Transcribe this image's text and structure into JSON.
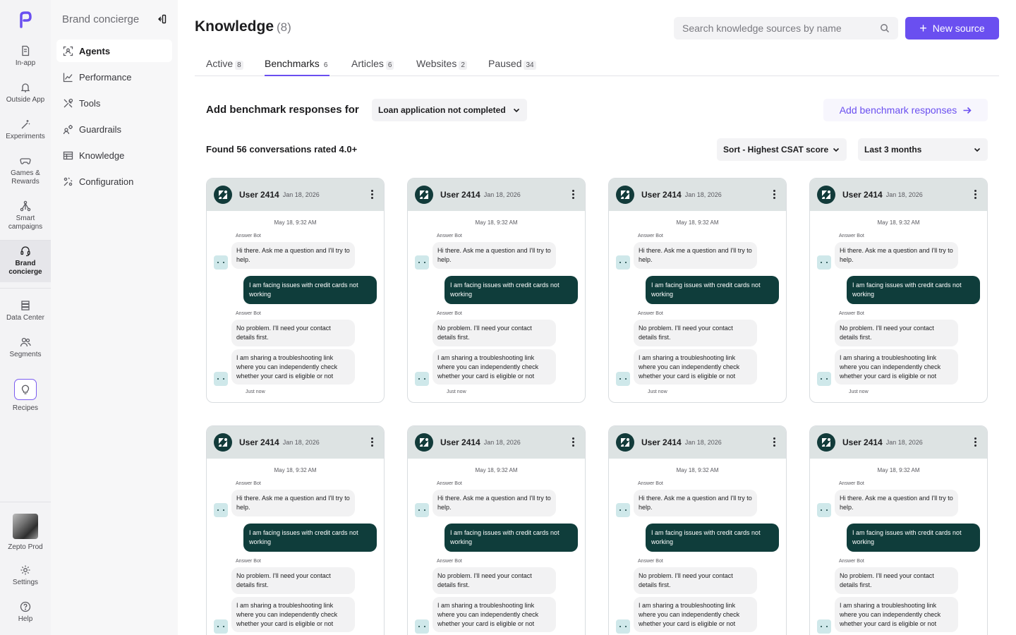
{
  "rail": {
    "items": [
      {
        "label": "In-app",
        "icon": "file-icon"
      },
      {
        "label": "Outside App",
        "icon": "bell-icon"
      },
      {
        "label": "Experiments",
        "icon": "wand-icon"
      },
      {
        "label": "Games & Rewards",
        "icon": "gamepad-icon"
      },
      {
        "label": "Smart campaigns",
        "icon": "network-icon"
      },
      {
        "label": "Brand concierge",
        "icon": "headset-icon"
      },
      {
        "label": "Data Center",
        "icon": "database-icon"
      },
      {
        "label": "Segments",
        "icon": "users-icon"
      },
      {
        "label": "Recipes",
        "icon": "bulb-icon"
      }
    ],
    "profile_label": "Zepto Prod",
    "settings_label": "Settings",
    "help_label": "Help"
  },
  "sidebar": {
    "title": "Brand concierge",
    "items": [
      {
        "label": "Agents",
        "icon": "agents-icon"
      },
      {
        "label": "Performance",
        "icon": "chart-icon"
      },
      {
        "label": "Tools",
        "icon": "tools-icon"
      },
      {
        "label": "Guardrails",
        "icon": "guardrails-icon"
      },
      {
        "label": "Knowledge",
        "icon": "table-icon"
      },
      {
        "label": "Configuration",
        "icon": "config-icon"
      }
    ]
  },
  "header": {
    "title": "Knowledge",
    "count": "(8)",
    "search_placeholder": "Search knowledge sources by name",
    "new_source_label": "New source"
  },
  "tabs": [
    {
      "label": "Active",
      "count": "8"
    },
    {
      "label": "Benchmarks",
      "count": "6"
    },
    {
      "label": "Articles",
      "count": "6"
    },
    {
      "label": "Websites",
      "count": "2"
    },
    {
      "label": "Paused",
      "count": "34"
    }
  ],
  "benchmarks": {
    "add_for_label": "Add benchmark responses for",
    "topic_selected": "Loan application not completed",
    "add_button_label": "Add benchmark responses",
    "found_label": "Found 56 conversations rated 4.0+",
    "sort_selected": "Sort - Highest CSAT score",
    "range_selected": "Last 3 months"
  },
  "conversation": {
    "user": "User 2414",
    "date": "Jan 18, 2026",
    "timestamp": "May 18, 9:32 AM",
    "bot_name": "Answer Bot",
    "msg1": "Hi there. Ask me a question and I'll try to help.",
    "msg2": "I am facing issues with credit cards not working",
    "msg3": "No problem. I'll need your contact details first.",
    "msg4": "I am sharing a troubleshooting link where you can independently check whether your card is eligible or not",
    "sent_time": "Just now"
  },
  "colors": {
    "accent": "#6a4ff0",
    "card_header": "#dde3e3",
    "user_bubble": "#0f3d3b"
  }
}
